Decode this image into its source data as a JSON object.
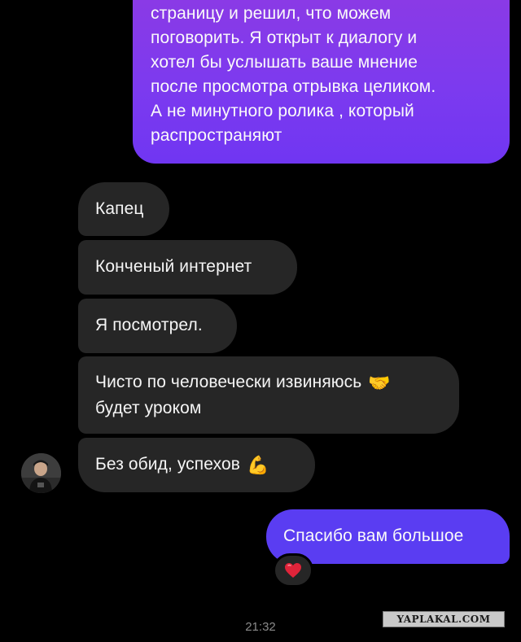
{
  "messages": {
    "outgoing_top": {
      "lines": [
        "страницу и решил, что можем",
        "поговорить. Я открыт к диалогу и",
        "хотел бы услышать ваше мнение",
        "после просмотра отрывка целиком.",
        "А не минутного ролика , который",
        "распространяют"
      ]
    },
    "incoming": [
      {
        "text": "Капец"
      },
      {
        "text": "Конченый интернет"
      },
      {
        "text": "Я посмотрел."
      },
      {
        "line1": "Чисто по человечески извиняюсь",
        "line2": "будет уроком",
        "emoji": "🤝"
      },
      {
        "text": "Без обид, успехов",
        "emoji": "💪"
      }
    ],
    "outgoing_bottom": {
      "text": "Спасибо вам большое"
    }
  },
  "reaction": {
    "emoji": "❤️",
    "color": "#e0243a"
  },
  "timestamp": "21:32",
  "watermark": "YAPLAKAL.COM",
  "colors": {
    "incoming_bubble": "#262626",
    "outgoing_top": "#7c3aef",
    "outgoing_bottom": "#5a3df2",
    "background": "#000000"
  }
}
